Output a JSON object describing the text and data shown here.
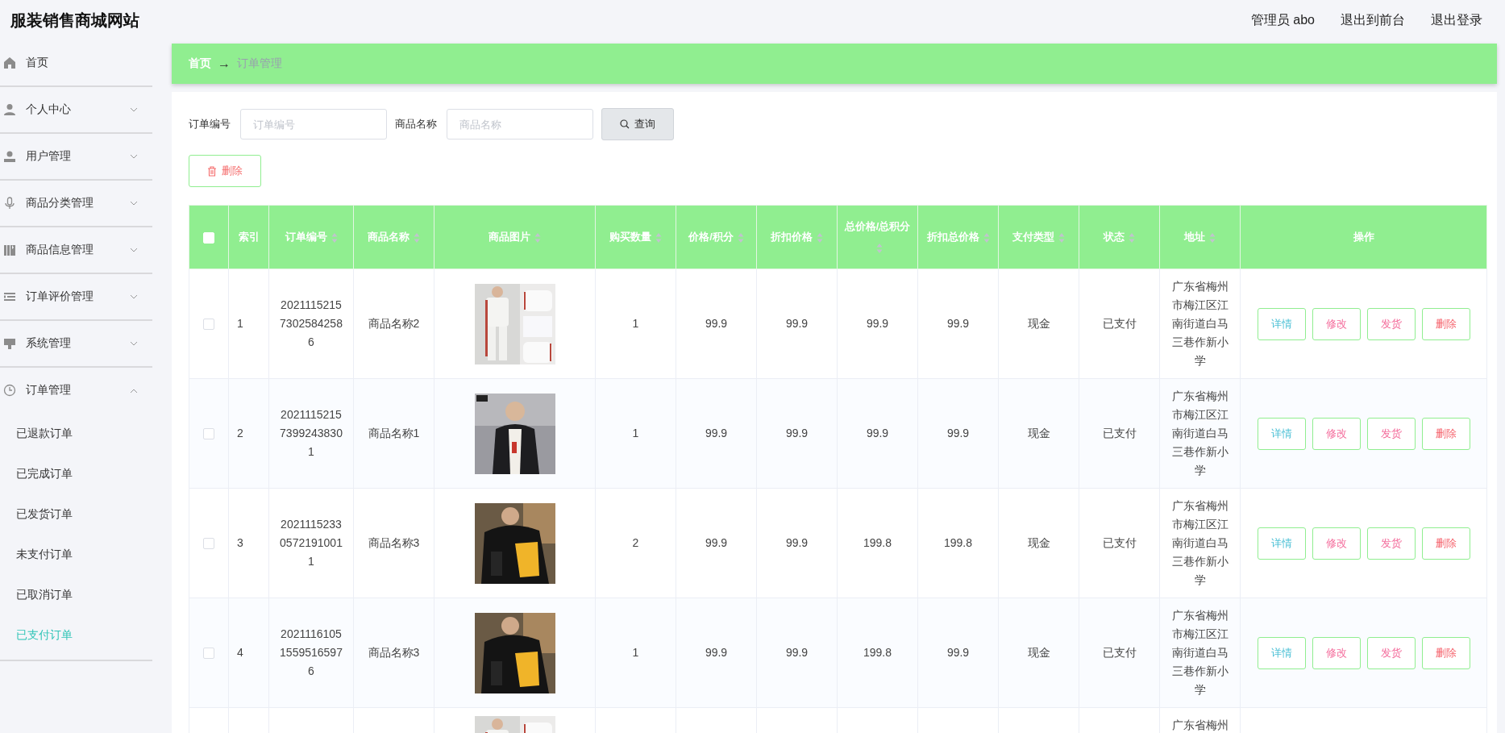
{
  "header": {
    "title": "服装销售商城网站",
    "links": [
      {
        "label": "管理员 abo"
      },
      {
        "label": "退出到前台"
      },
      {
        "label": "退出登录"
      }
    ]
  },
  "sidebar": {
    "items": [
      {
        "label": "首页",
        "kind": "link"
      },
      {
        "label": "个人中心",
        "kind": "submenu",
        "expanded": false
      },
      {
        "label": "用户管理",
        "kind": "submenu",
        "expanded": false
      },
      {
        "label": "商品分类管理",
        "kind": "submenu",
        "expanded": false
      },
      {
        "label": "商品信息管理",
        "kind": "submenu",
        "expanded": false
      },
      {
        "label": "订单评价管理",
        "kind": "submenu",
        "expanded": false
      },
      {
        "label": "系统管理",
        "kind": "submenu",
        "expanded": false
      },
      {
        "label": "订单管理",
        "kind": "submenu",
        "expanded": true,
        "children": [
          {
            "label": "已退款订单",
            "selected": false
          },
          {
            "label": "已完成订单",
            "selected": false
          },
          {
            "label": "已发货订单",
            "selected": false
          },
          {
            "label": "未支付订单",
            "selected": false
          },
          {
            "label": "已取消订单",
            "selected": false
          },
          {
            "label": "已支付订单",
            "selected": true
          }
        ]
      }
    ]
  },
  "breadcrumb": [
    {
      "label": "首页",
      "current": false
    },
    {
      "label": "→",
      "kind": "separator"
    },
    {
      "label": "订单管理",
      "current": true
    }
  ],
  "search": {
    "fields": [
      {
        "label": "订单编号",
        "placeholder": "订单编号"
      },
      {
        "label": "商品名称",
        "placeholder": "商品名称"
      }
    ],
    "button": "查询"
  },
  "delete_button": "删除",
  "table": {
    "select_all": {
      "checked": false
    },
    "columns": [
      {
        "label": "索引",
        "sortable": false
      },
      {
        "label": "订单编号",
        "sortable": true
      },
      {
        "label": "商品名称",
        "sortable": true
      },
      {
        "label": "商品图片",
        "sortable": true
      },
      {
        "label": "购买数量",
        "sortable": true
      },
      {
        "label": "价格/积分",
        "sortable": true
      },
      {
        "label": "折扣价格",
        "sortable": true
      },
      {
        "label": "总价格/总积分",
        "sortable": true
      },
      {
        "label": "折扣总价格",
        "sortable": true
      },
      {
        "label": "支付类型",
        "sortable": true
      },
      {
        "label": "状态",
        "sortable": true
      },
      {
        "label": "地址",
        "sortable": true
      },
      {
        "label": "操作",
        "sortable": false
      }
    ],
    "rows": [
      {
        "kind": "full",
        "checked": false,
        "cells": [
          "1",
          "202111521573025842586",
          "商品名称2",
          {
            "kind": "picture"
          },
          "1",
          "99.9",
          "99.9",
          "99.9",
          "99.9",
          "现金",
          "已支付",
          "广东省梅州市梅江区江南街道白马三巷作新小学"
        ],
        "actions": [
          {
            "label": "详情",
            "color": "#4ec1d6"
          },
          {
            "label": "修改",
            "color": "#f46b9b"
          },
          {
            "label": "发货",
            "color": "#f46b9b"
          },
          {
            "label": "删除",
            "color": "#f5606a"
          }
        ]
      },
      {
        "kind": "full",
        "checked": false,
        "cells": [
          "2",
          "202111521573992438301",
          "商品名称1",
          {
            "kind": "picture"
          },
          "1",
          "99.9",
          "99.9",
          "99.9",
          "99.9",
          "现金",
          "已支付",
          "广东省梅州市梅江区江南街道白马三巷作新小学"
        ],
        "actions": [
          {
            "label": "详情",
            "color": "#4ec1d6"
          },
          {
            "label": "修改",
            "color": "#f46b9b"
          },
          {
            "label": "发货",
            "color": "#f46b9b"
          },
          {
            "label": "删除",
            "color": "#f5606a"
          }
        ]
      },
      {
        "kind": "full",
        "checked": false,
        "cells": [
          "3",
          "202111523305721910011",
          "商品名称3",
          {
            "kind": "picture"
          },
          "2",
          "99.9",
          "99.9",
          "199.8",
          "199.8",
          "现金",
          "已支付",
          "广东省梅州市梅江区江南街道白马三巷作新小学"
        ],
        "actions": [
          {
            "label": "详情",
            "color": "#4ec1d6"
          },
          {
            "label": "修改",
            "color": "#f46b9b"
          },
          {
            "label": "发货",
            "color": "#f46b9b"
          },
          {
            "label": "删除",
            "color": "#f5606a"
          }
        ]
      },
      {
        "kind": "full",
        "checked": false,
        "cells": [
          "4",
          "202111610515595165976",
          "商品名称3",
          {
            "kind": "picture"
          },
          "1",
          "99.9",
          "99.9",
          "199.8",
          "99.9",
          "现金",
          "已支付",
          "广东省梅州市梅江区江南街道白马三巷作新小学"
        ],
        "actions": [
          {
            "label": "详情",
            "color": "#4ec1d6"
          },
          {
            "label": "修改",
            "color": "#f46b9b"
          },
          {
            "label": "发货",
            "color": "#f46b9b"
          },
          {
            "label": "删除",
            "color": "#f5606a"
          }
        ]
      },
      {
        "kind": "partial",
        "image": {
          "kind": "picture"
        },
        "address": "广东省梅州"
      }
    ]
  }
}
